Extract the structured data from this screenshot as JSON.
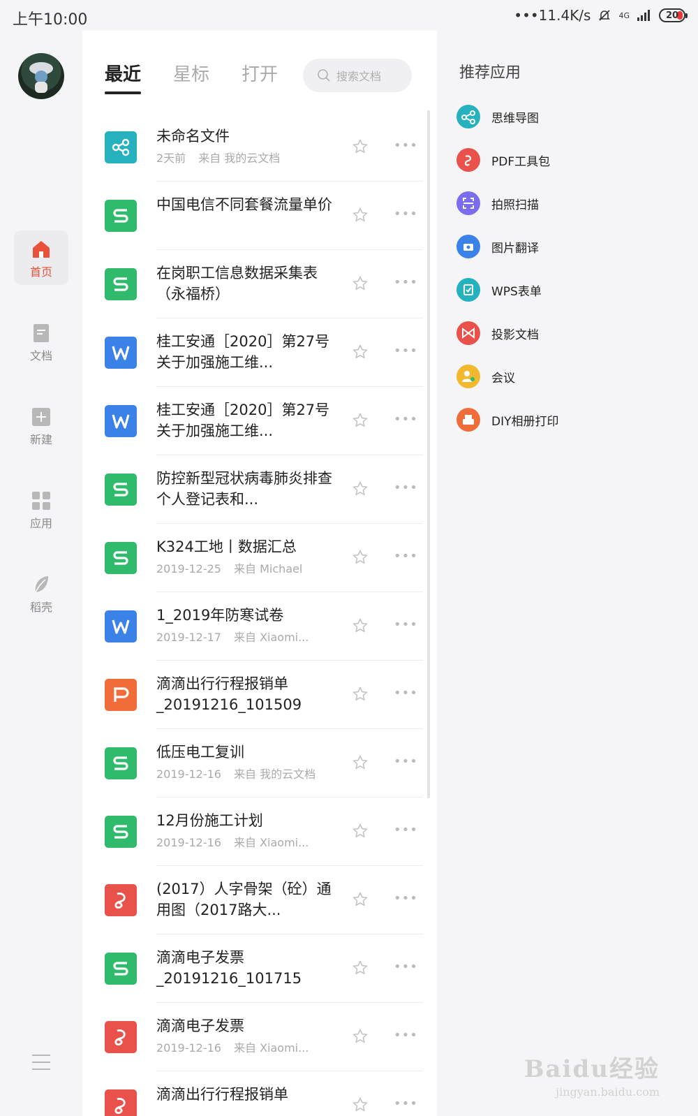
{
  "status": {
    "time": "上午10:00",
    "network_speed": "•••11.4K/s",
    "signal_type": "4G",
    "battery": "20"
  },
  "rail": {
    "items": [
      {
        "label": "首页",
        "icon": "home-icon",
        "active": true
      },
      {
        "label": "文档",
        "icon": "document-icon"
      },
      {
        "label": "新建",
        "icon": "plus-icon"
      },
      {
        "label": "应用",
        "icon": "grid-icon"
      },
      {
        "label": "稻壳",
        "icon": "leaf-icon"
      }
    ]
  },
  "tabs": [
    {
      "label": "最近",
      "active": true
    },
    {
      "label": "星标"
    },
    {
      "label": "打开"
    }
  ],
  "search": {
    "placeholder": "搜索文档"
  },
  "files": [
    {
      "type": "mind",
      "title": "未命名文件",
      "time": "2天前",
      "source": "来自 我的云文档"
    },
    {
      "type": "s",
      "title": "中国电信不同套餐流量单价"
    },
    {
      "type": "s",
      "title": "在岗职工信息数据采集表（永福桥）"
    },
    {
      "type": "w",
      "title": "桂工安通［2020］第27号关于加强施工维..."
    },
    {
      "type": "w",
      "title": "桂工安通［2020］第27号关于加强施工维..."
    },
    {
      "type": "s",
      "title": "防控新型冠状病毒肺炎排查个人登记表和..."
    },
    {
      "type": "s",
      "title": "K324工地丨数据汇总",
      "time": "2019-12-25",
      "source": "来自 Michael"
    },
    {
      "type": "w",
      "title": "1_2019年防寒试卷",
      "time": "2019-12-17",
      "source": "来自 Xiaomi..."
    },
    {
      "type": "p",
      "title": "滴滴出行行程报销单_20191216_101509"
    },
    {
      "type": "s",
      "title": "低压电工复训",
      "time": "2019-12-16",
      "source": "来自 我的云文档"
    },
    {
      "type": "s",
      "title": "12月份施工计划",
      "time": "2019-12-16",
      "source": "来自 Xiaomi..."
    },
    {
      "type": "pdf",
      "title": "(2017）人字骨架（砼）通用图（2017路大..."
    },
    {
      "type": "s",
      "title": "滴滴电子发票_20191216_101715"
    },
    {
      "type": "pdf",
      "title": "滴滴电子发票",
      "time": "2019-12-16",
      "source": "来自 Xiaomi..."
    },
    {
      "type": "pdf",
      "title": "滴滴出行行程报销单"
    }
  ],
  "recommended": {
    "title": "推荐应用",
    "apps": [
      {
        "label": "思维导图",
        "icon": "mindmap-icon",
        "color": "#26b1bf"
      },
      {
        "label": "PDF工具包",
        "icon": "pdf-toolkit-icon",
        "color": "#e8524a"
      },
      {
        "label": "拍照扫描",
        "icon": "scan-icon",
        "color": "#7b6cf0"
      },
      {
        "label": "图片翻译",
        "icon": "image-translate-icon",
        "color": "#3b82e8"
      },
      {
        "label": "WPS表单",
        "icon": "form-icon",
        "color": "#26b1bf"
      },
      {
        "label": "投影文档",
        "icon": "projection-icon",
        "color": "#e8524a"
      },
      {
        "label": "会议",
        "icon": "meeting-icon",
        "color": "#f2b82e"
      },
      {
        "label": "DIY相册打印",
        "icon": "print-icon",
        "color": "#f06d3a"
      }
    ]
  },
  "watermark": {
    "main": "Baidu经验",
    "sub": "jingyan.baidu.com"
  }
}
